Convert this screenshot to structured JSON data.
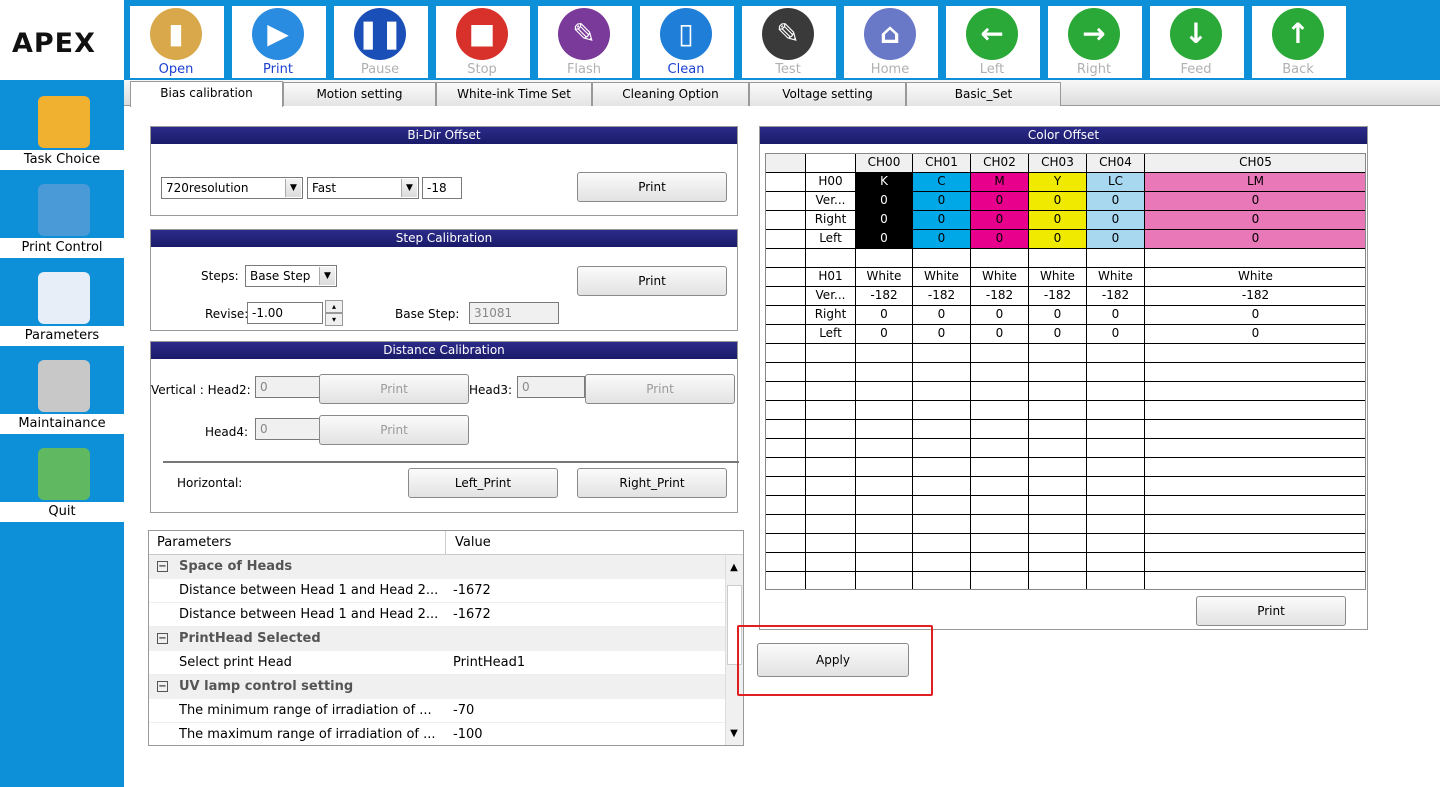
{
  "app": {
    "logo": "APEX"
  },
  "colors": {
    "toolbar_bg": "#0e90d8",
    "panel_title_bg": "#1b1b6a",
    "highlight_box": "#e02020"
  },
  "toolbar": [
    {
      "label": "Open",
      "icon": "folder-icon",
      "state": "on",
      "color": "#d8a84a",
      "glyph": "▮"
    },
    {
      "label": "Print",
      "icon": "play-icon",
      "state": "on",
      "color": "#2a8ce0",
      "glyph": "▶"
    },
    {
      "label": "Pause",
      "icon": "pause-icon",
      "state": "off",
      "color": "#1a4fb8",
      "glyph": "❚❚"
    },
    {
      "label": "Stop",
      "icon": "stop-icon",
      "state": "off",
      "color": "#d8302a",
      "glyph": "■"
    },
    {
      "label": "Flash",
      "icon": "flash-icon",
      "state": "off",
      "color": "#7a3a9a",
      "glyph": "✎"
    },
    {
      "label": "Clean",
      "icon": "ink-bottle-icon",
      "state": "on",
      "color": "#1e7ed8",
      "glyph": "▯"
    },
    {
      "label": "Test",
      "icon": "test-page-icon",
      "state": "off",
      "color": "#3a3a3a",
      "glyph": "✎"
    },
    {
      "label": "Home",
      "icon": "home-icon",
      "state": "off",
      "color": "#6a78c8",
      "glyph": "⌂"
    },
    {
      "label": "Left",
      "icon": "arrow-left-icon",
      "state": "off",
      "color": "#2aa838",
      "glyph": "←"
    },
    {
      "label": "Right",
      "icon": "arrow-right-icon",
      "state": "off",
      "color": "#2aa838",
      "glyph": "→"
    },
    {
      "label": "Feed",
      "icon": "arrow-down-icon",
      "state": "off",
      "color": "#2aa838",
      "glyph": "↓"
    },
    {
      "label": "Back",
      "icon": "arrow-up-icon",
      "state": "off",
      "color": "#2aa838",
      "glyph": "↑"
    }
  ],
  "sidebar": [
    {
      "label": "Task Choice",
      "icon": "folder-icon"
    },
    {
      "label": "Print Control",
      "icon": "disc-icon"
    },
    {
      "label": "Parameters",
      "icon": "gear-icon"
    },
    {
      "label": "Maintainance",
      "icon": "tools-icon"
    },
    {
      "label": "Quit",
      "icon": "user-exit-icon"
    }
  ],
  "tabs": [
    "Bias calibration",
    "Motion setting",
    "White-ink Time Set",
    "Cleaning Option",
    "Voltage setting",
    "Basic_Set"
  ],
  "bidir": {
    "title": "Bi-Dir Offset",
    "resolution": "720resolution",
    "speed": "Fast",
    "offset": "-18",
    "print_label": "Print"
  },
  "step": {
    "title": "Step Calibration",
    "steps_label": "Steps:",
    "steps_value": "Base Step",
    "revise_label": "Revise:",
    "revise_value": "-1.00",
    "base_step_label": "Base Step:",
    "base_step_value": "31081",
    "print_label": "Print"
  },
  "distance": {
    "title": "Distance  Calibration",
    "vertical_label": "Vertical : Head2:",
    "head2_value": "0",
    "head3_label": "Head3:",
    "head3_value": "0",
    "head4_label": "Head4:",
    "head4_value": "0",
    "print_label": "Print",
    "horizontal_label": "Horizontal:",
    "left_print": "Left_Print",
    "right_print": "Right_Print"
  },
  "params": {
    "col_name": "Parameters",
    "col_value": "Value",
    "rows": [
      {
        "type": "section",
        "name": "Space of Heads"
      },
      {
        "type": "item",
        "name": "Distance between Head 1 and Head 2...",
        "value": "-1672"
      },
      {
        "type": "item",
        "name": "Distance between Head 1 and Head 2...",
        "value": "-1672"
      },
      {
        "type": "section",
        "name": "PrintHead Selected"
      },
      {
        "type": "item",
        "name": "Select print Head",
        "value": "PrintHead1"
      },
      {
        "type": "section",
        "name": "UV lamp control setting"
      },
      {
        "type": "item",
        "name": "The minimum range of irradiation of ...",
        "value": "-70"
      },
      {
        "type": "item",
        "name": "The maximum range of irradiation of ...",
        "value": "-100"
      }
    ]
  },
  "color_offset": {
    "title": "Color Offset",
    "channels": [
      "CH00",
      "CH01",
      "CH02",
      "CH03",
      "CH04",
      "CH05"
    ],
    "block1": {
      "head": "H00",
      "colors": [
        "K",
        "C",
        "M",
        "Y",
        "LC",
        "LM"
      ],
      "swatches": [
        "#000000",
        "#00a8e8",
        "#e8008c",
        "#f0ea00",
        "#a8d8f0",
        "#e878b8"
      ],
      "text_colors": [
        "#ffffff",
        "#000000",
        "#000000",
        "#000000",
        "#000000",
        "#000000"
      ],
      "rows": [
        {
          "label": "Ver...",
          "values": [
            "0",
            "0",
            "0",
            "0",
            "0",
            "0"
          ]
        },
        {
          "label": "Right",
          "values": [
            "0",
            "0",
            "0",
            "0",
            "0",
            "0"
          ]
        },
        {
          "label": "Left",
          "values": [
            "0",
            "0",
            "0",
            "0",
            "0",
            "0"
          ]
        }
      ]
    },
    "block2": {
      "head": "H01",
      "colors": [
        "White",
        "White",
        "White",
        "White",
        "White",
        "White"
      ],
      "rows": [
        {
          "label": "Ver...",
          "values": [
            "-182",
            "-182",
            "-182",
            "-182",
            "-182",
            "-182"
          ]
        },
        {
          "label": "Right",
          "values": [
            "0",
            "0",
            "0",
            "0",
            "0",
            "0"
          ]
        },
        {
          "label": "Left",
          "values": [
            "0",
            "0",
            "0",
            "0",
            "0",
            "0"
          ]
        }
      ]
    },
    "print_label": "Print"
  },
  "apply_label": "Apply"
}
